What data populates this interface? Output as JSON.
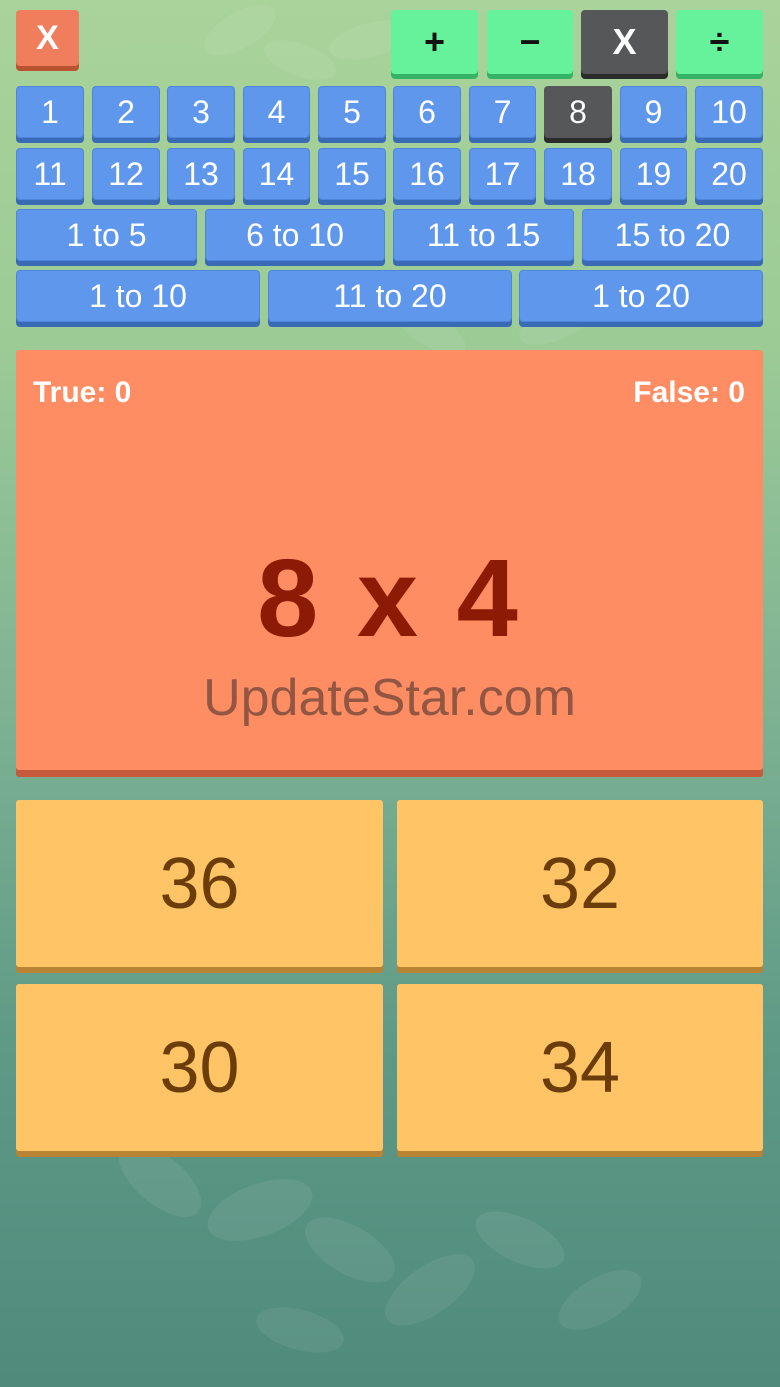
{
  "header": {
    "close_label": "X",
    "operations": [
      {
        "label": "+",
        "selected": false
      },
      {
        "label": "−",
        "selected": false
      },
      {
        "label": "X",
        "selected": true
      },
      {
        "label": "÷",
        "selected": false
      }
    ]
  },
  "numbers": {
    "row1": [
      "1",
      "2",
      "3",
      "4",
      "5",
      "6",
      "7",
      "8",
      "9",
      "10"
    ],
    "row2": [
      "11",
      "12",
      "13",
      "14",
      "15",
      "16",
      "17",
      "18",
      "19",
      "20"
    ],
    "selected": "8"
  },
  "ranges": {
    "row1": [
      "1 to 5",
      "6 to 10",
      "11 to 15",
      "15 to 20"
    ],
    "row2": [
      "1 to 10",
      "11 to 20",
      "1 to 20"
    ]
  },
  "score": {
    "true_label": "True: 0",
    "false_label": "False: 0"
  },
  "question": {
    "text": "8 x 4",
    "watermark": "UpdateStar.com"
  },
  "answers": [
    "36",
    "32",
    "30",
    "34"
  ],
  "colors": {
    "number_button": "#5f97ec",
    "selected_button": "#555758",
    "operation_button": "#66f29a",
    "question_panel": "#ff8d63",
    "answer_button": "#ffc466"
  }
}
